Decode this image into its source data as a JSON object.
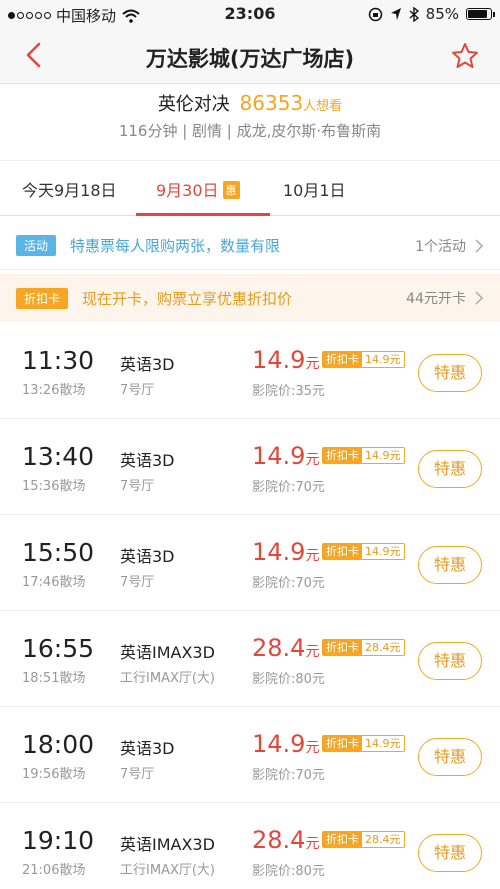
{
  "status_bar": {
    "carrier": "中国移动",
    "time": "23:06",
    "battery": "85%",
    "battery_level": 0.85
  },
  "nav": {
    "title": "万达影城(万达广场店)",
    "back_icon": "chevron-left-icon",
    "favorite_icon": "star-outline-icon"
  },
  "movie": {
    "name": "英伦对决",
    "want_count": "86353",
    "want_suffix": "人想看",
    "meta": "116分钟 | 剧情 | 成龙,皮尔斯·布鲁斯南"
  },
  "date_tabs": [
    {
      "label": "今天9月18日",
      "selected": false
    },
    {
      "label": "9月30日",
      "badge": "惠",
      "selected": true
    },
    {
      "label": "10月1日",
      "selected": false
    }
  ],
  "activity": {
    "tag": "活动",
    "text": "特惠票每人限购两张，数量有限",
    "right": "1个活动"
  },
  "card_promo": {
    "tag": "折扣卡",
    "text": "现在开卡，购票立享优惠折扣价",
    "right": "44元开卡"
  },
  "showtimes": [
    {
      "start": "11:30",
      "end": "13:26散场",
      "lang": "英语3D",
      "hall": "7号厅",
      "price": "14.9",
      "yuan": "元",
      "card_label": "折扣卡",
      "card_price": "14.9元",
      "cinema_price": "影院价:35元",
      "button": "特惠"
    },
    {
      "start": "13:40",
      "end": "15:36散场",
      "lang": "英语3D",
      "hall": "7号厅",
      "price": "14.9",
      "yuan": "元",
      "card_label": "折扣卡",
      "card_price": "14.9元",
      "cinema_price": "影院价:70元",
      "button": "特惠"
    },
    {
      "start": "15:50",
      "end": "17:46散场",
      "lang": "英语3D",
      "hall": "7号厅",
      "price": "14.9",
      "yuan": "元",
      "card_label": "折扣卡",
      "card_price": "14.9元",
      "cinema_price": "影院价:70元",
      "button": "特惠"
    },
    {
      "start": "16:55",
      "end": "18:51散场",
      "lang": "英语IMAX3D",
      "hall": "工行IMAX厅(大)",
      "price": "28.4",
      "yuan": "元",
      "card_label": "折扣卡",
      "card_price": "28.4元",
      "cinema_price": "影院价:80元",
      "button": "特惠"
    },
    {
      "start": "18:00",
      "end": "19:56散场",
      "lang": "英语3D",
      "hall": "7号厅",
      "price": "14.9",
      "yuan": "元",
      "card_label": "折扣卡",
      "card_price": "14.9元",
      "cinema_price": "影院价:70元",
      "button": "特惠"
    },
    {
      "start": "19:10",
      "end": "21:06散场",
      "lang": "英语IMAX3D",
      "hall": "工行IMAX厅(大)",
      "price": "28.4",
      "yuan": "元",
      "card_label": "折扣卡",
      "card_price": "28.4元",
      "cinema_price": "影院价:80元",
      "button": "特惠"
    }
  ],
  "colors": {
    "accent_red": "#e5463b",
    "accent_orange": "#f6a623",
    "activity_blue": "#5bb4e6"
  }
}
